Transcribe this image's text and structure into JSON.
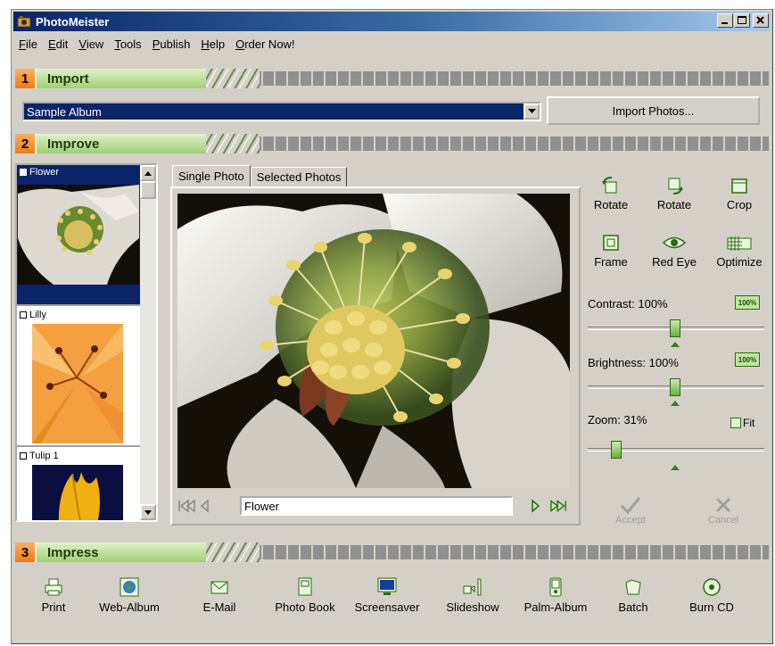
{
  "window": {
    "title": "PhotoMeister"
  },
  "menu": [
    {
      "u": "F",
      "rest": "ile"
    },
    {
      "u": "E",
      "rest": "dit"
    },
    {
      "u": "V",
      "rest": "iew"
    },
    {
      "u": "T",
      "rest": "ools"
    },
    {
      "u": "P",
      "rest": "ublish"
    },
    {
      "u": "H",
      "rest": "elp"
    },
    {
      "u": "O",
      "rest": "rder Now!"
    }
  ],
  "sections": {
    "import": {
      "num": "1",
      "label": "Import"
    },
    "improve": {
      "num": "2",
      "label": "Improve"
    },
    "impress": {
      "num": "3",
      "label": "Impress"
    }
  },
  "import": {
    "album_value": "Sample Album",
    "import_button": "Import Photos..."
  },
  "thumbnails": [
    {
      "label": "Flower",
      "selected": true
    },
    {
      "label": "Lilly",
      "selected": false
    },
    {
      "label": "Tulip 1",
      "selected": false
    }
  ],
  "tabs": {
    "single": "Single Photo",
    "selected": "Selected Photos"
  },
  "viewer": {
    "photo_name": "Flower"
  },
  "tools": {
    "rotate_left": "Rotate",
    "rotate_right": "Rotate",
    "crop": "Crop",
    "frame": "Frame",
    "red_eye": "Red Eye",
    "optimize": "Optimize"
  },
  "sliders": {
    "contrast_label": "Contrast: 100%",
    "brightness_label": "Brightness: 100%",
    "zoom_label": "Zoom: 31%",
    "reset_badge": "100%",
    "fit_label": "Fit"
  },
  "actions": {
    "accept": "Accept",
    "cancel": "Cancel"
  },
  "impress": [
    {
      "label": "Print",
      "icon": "printer-icon"
    },
    {
      "label": "Web-Album",
      "icon": "globe-icon"
    },
    {
      "label": "E-Mail",
      "icon": "envelope-icon"
    },
    {
      "label": "Photo Book",
      "icon": "book-icon"
    },
    {
      "label": "Screensaver",
      "icon": "monitor-icon"
    },
    {
      "label": "Slideshow",
      "icon": "projector-icon"
    },
    {
      "label": "Palm-Album",
      "icon": "palm-icon"
    },
    {
      "label": "Batch",
      "icon": "folder-icon"
    },
    {
      "label": "Burn CD",
      "icon": "cd-icon"
    }
  ],
  "colors": {
    "title_bar": "#0a246a",
    "section_green": "#9fd072",
    "section_orange": "#f07a10",
    "selection": "#0a246a"
  }
}
